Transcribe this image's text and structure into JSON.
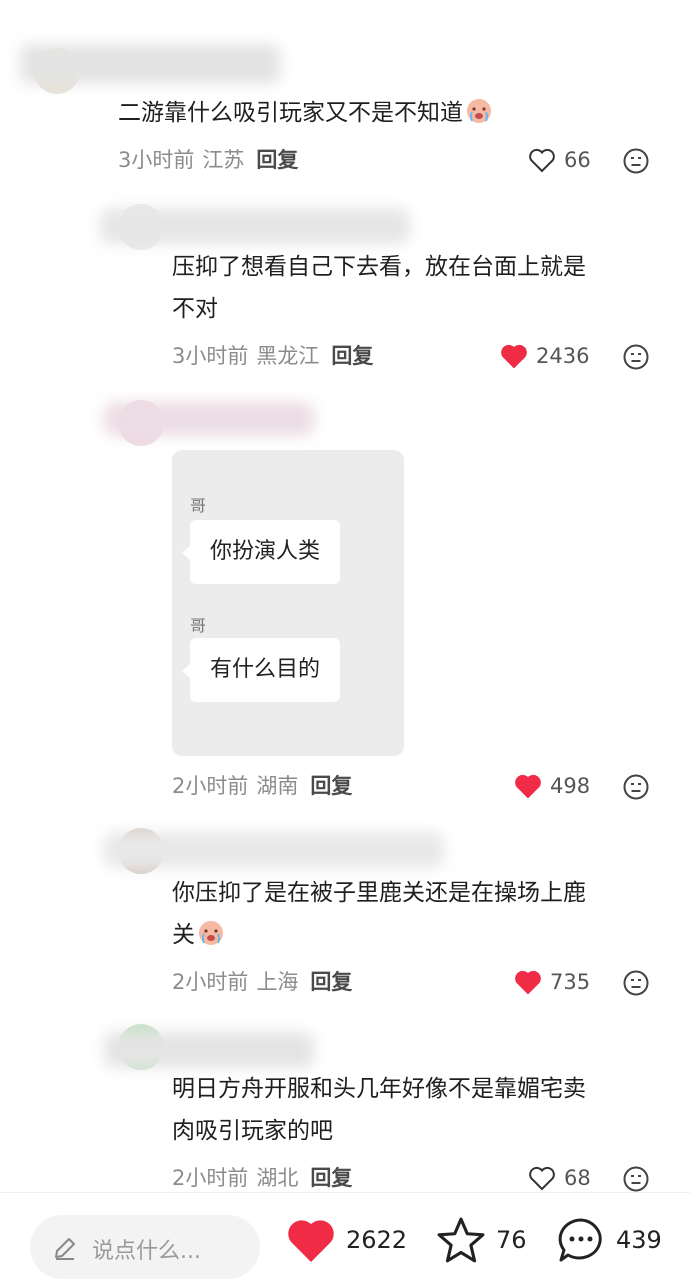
{
  "comments": [
    {
      "text": "二游靠什么吸引玩家又不是不知道",
      "has_emoji": true,
      "time": "3小时前",
      "region": "江苏",
      "reply_label": "回复",
      "likes": "66",
      "liked": false
    },
    {
      "text": "压抑了想看自己下去看，放在台面上就是不对",
      "line1": "压抑了想看自己下去看，放在台面上就是",
      "line2": "不对",
      "time": "3小时前",
      "region": "黑龙江",
      "reply_label": "回复",
      "likes": "2436",
      "liked": true
    },
    {
      "image": {
        "messages": [
          {
            "name": "哥",
            "text": "你扮演人类"
          },
          {
            "name": "哥",
            "text": "有什么目的"
          }
        ]
      },
      "time": "2小时前",
      "region": "湖南",
      "reply_label": "回复",
      "likes": "498",
      "liked": true
    },
    {
      "line1": "你压抑了是在被子里鹿关还是在操场上鹿",
      "line2": "关",
      "has_emoji": true,
      "time": "2小时前",
      "region": "上海",
      "reply_label": "回复",
      "likes": "735",
      "liked": true
    },
    {
      "line1": "明日方舟开服和头几年好像不是靠媚宅卖",
      "line2": "肉吸引玩家的吧",
      "time": "2小时前",
      "region": "湖北",
      "reply_label": "回复",
      "likes": "68",
      "liked": false
    }
  ],
  "bottom_bar": {
    "input_placeholder": "说点什么...",
    "likes": "2622",
    "favorites": "76",
    "comments": "439"
  },
  "colors": {
    "like_red": "#f02b45",
    "meta_gray": "#8c8c8c",
    "chat_bg": "#ececec"
  },
  "icons": [
    "pencil-icon",
    "heart-icon",
    "star-icon",
    "comment-bubble-icon",
    "dislike-face-icon",
    "crying-emoji"
  ]
}
